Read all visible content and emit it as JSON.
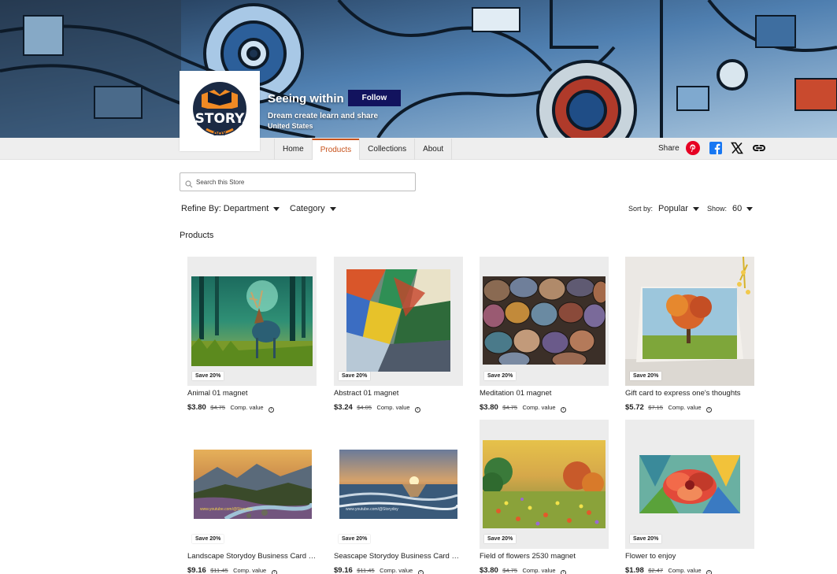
{
  "store": {
    "name": "Seeing within",
    "follow_label": "Follow",
    "tagline": "Dream create learn and share",
    "location": "United States",
    "logo_text": "STORY",
    "logo_subtext": "DOY"
  },
  "nav": {
    "tabs": [
      "Home",
      "Products",
      "Collections",
      "About"
    ],
    "active_tab": "Products",
    "share_label": "Share",
    "social_icons": [
      "pinterest-icon",
      "facebook-icon",
      "x-icon",
      "link-icon"
    ]
  },
  "search": {
    "placeholder": "Search this Store",
    "value": ""
  },
  "filters": {
    "refine_label": "Refine By: Department",
    "category_label": "Category",
    "sort_label": "Sort by:",
    "sort_value": "Popular",
    "show_label": "Show:",
    "show_value": "60"
  },
  "section_title": "Products",
  "products": [
    {
      "name": "Animal 01 magnet",
      "badge": "Save 20%",
      "price": "$3.80",
      "old_price": "$4.75",
      "comp": "Comp. value"
    },
    {
      "name": "Abstract 01 magnet",
      "badge": "Save 20%",
      "price": "$3.24",
      "old_price": "$4.05",
      "comp": "Comp. value"
    },
    {
      "name": "Meditation 01 magnet",
      "badge": "Save 20%",
      "price": "$3.80",
      "old_price": "$4.75",
      "comp": "Comp. value"
    },
    {
      "name": "Gift card to express one's thoughts",
      "badge": "Save 20%",
      "price": "$5.72",
      "old_price": "$7.15",
      "comp": "Comp. value"
    },
    {
      "name": "Landscape Storydoy Business Card Magnet",
      "badge": "Save 20%",
      "price": "$9.16",
      "old_price": "$11.45",
      "comp": "Comp. value",
      "image_text": "www.youtube.com/@Storydoy"
    },
    {
      "name": "Seascape Storydoy Business Card Magnet",
      "badge": "Save 20%",
      "price": "$9.16",
      "old_price": "$11.45",
      "comp": "Comp. value",
      "image_text": "www.youtube.com/@Storydoy"
    },
    {
      "name": "Field of flowers 2530 magnet",
      "badge": "Save 20%",
      "price": "$3.80",
      "old_price": "$4.75",
      "comp": "Comp. value"
    },
    {
      "name": "Flower to enjoy",
      "badge": "Save 20%",
      "price": "$1.98",
      "old_price": "$2.47",
      "comp": "Comp. value"
    }
  ],
  "colors": {
    "follow_button": "#12135e",
    "active_tab": "#c8531c",
    "pinterest": "#e60023",
    "facebook": "#1877f2"
  }
}
